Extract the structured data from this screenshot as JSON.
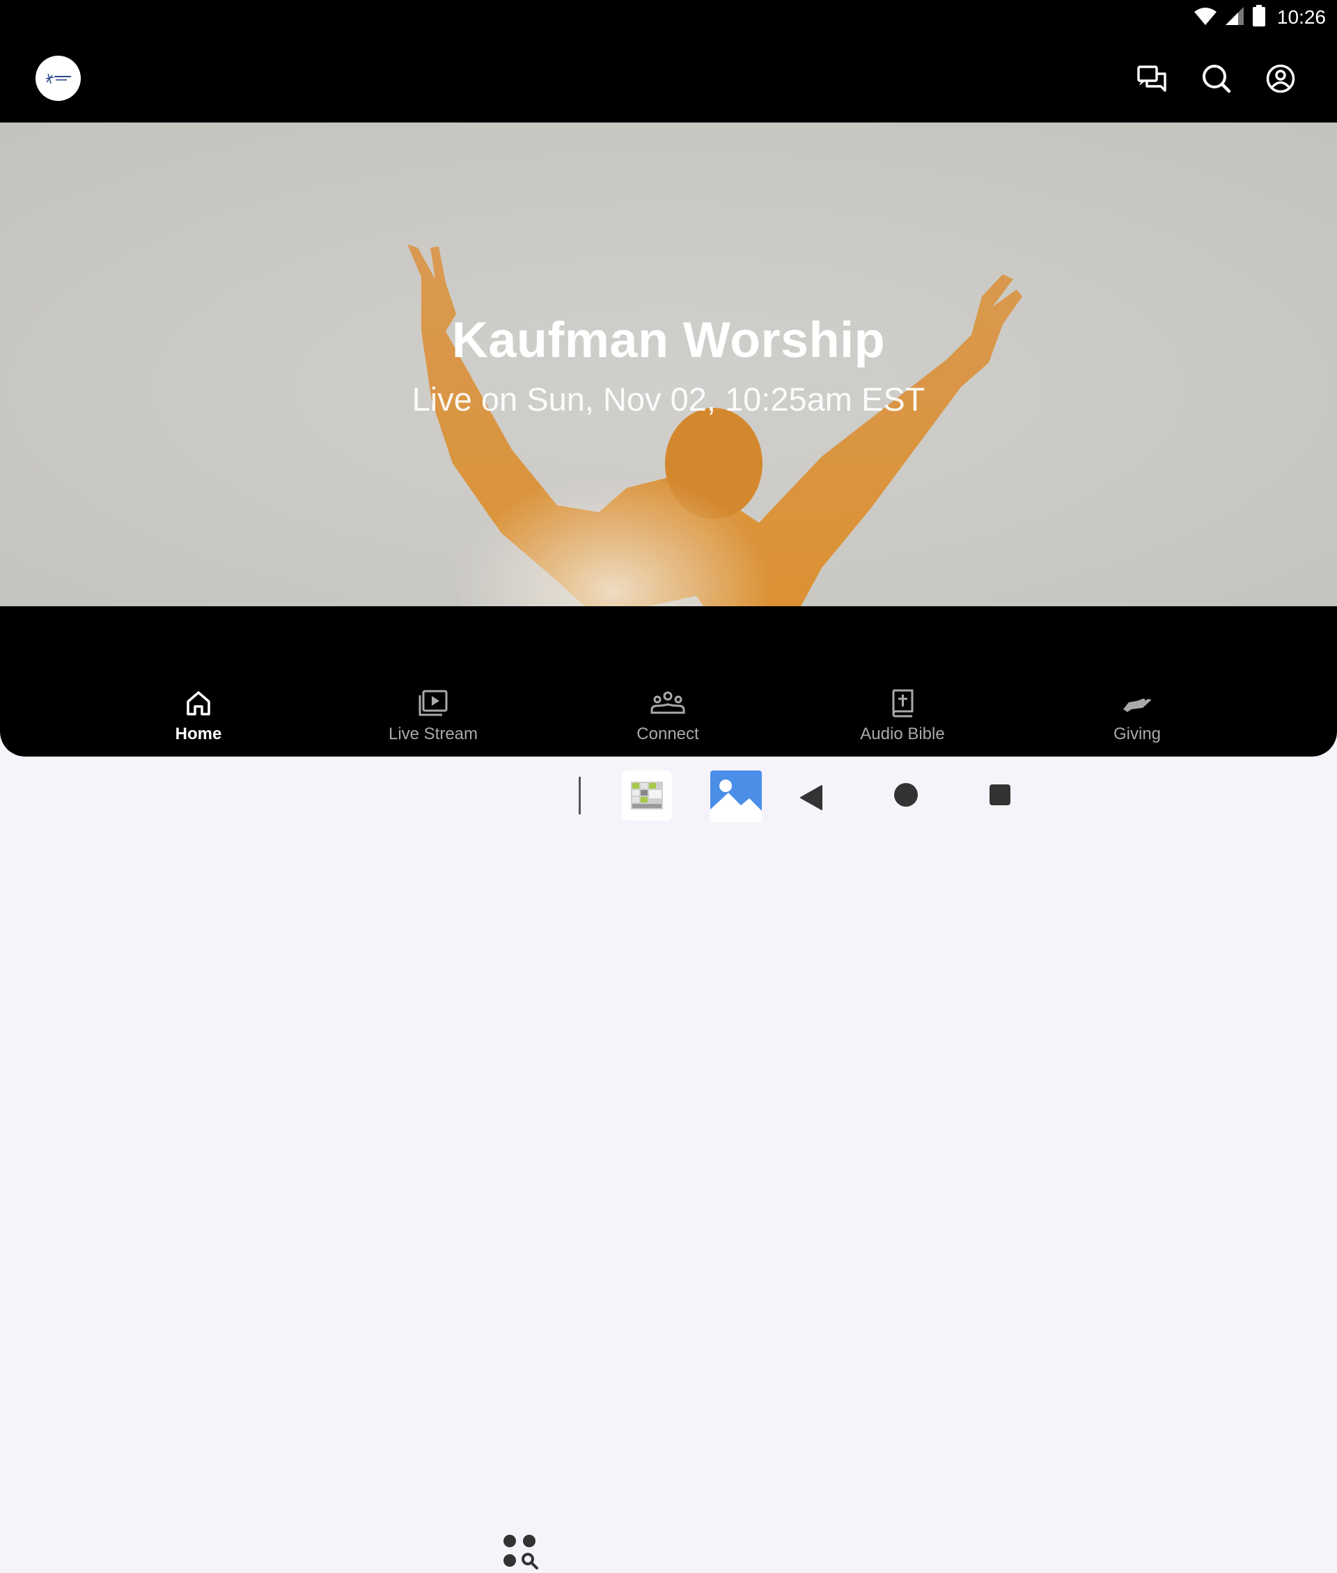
{
  "status_bar": {
    "time": "10:26",
    "icons": [
      "wifi-icon",
      "cell-signal-icon",
      "battery-icon"
    ]
  },
  "header": {
    "logo_text": "Kaufman Church",
    "actions": [
      "chat-icon",
      "search-icon",
      "account-icon"
    ]
  },
  "hero": {
    "title": "Kaufman Worship",
    "subtitle": "Live on Sun, Nov 02, 10:25am EST"
  },
  "bottom_nav": {
    "items": [
      {
        "label": "Home",
        "icon": "home-icon",
        "active": true
      },
      {
        "label": "Live Stream",
        "icon": "live-stream-icon",
        "active": false
      },
      {
        "label": "Connect",
        "icon": "people-icon",
        "active": false
      },
      {
        "label": "Audio Bible",
        "icon": "bible-icon",
        "active": false
      },
      {
        "label": "Giving",
        "icon": "giving-hand-icon",
        "active": false
      }
    ]
  },
  "system_nav": {
    "buttons": [
      "app-drawer-search-icon",
      "calendar-app-icon",
      "photos-app-icon",
      "back-icon",
      "home-circle-icon",
      "recents-icon"
    ]
  },
  "colors": {
    "background": "#000000",
    "nav_active": "#ffffff",
    "nav_inactive": "#a9a9a9",
    "hero_accent": "#e59a35"
  }
}
